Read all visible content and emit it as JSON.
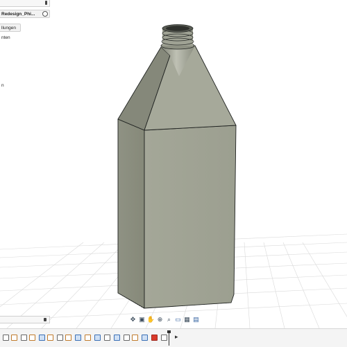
{
  "browser": {
    "component_name": "Redesign_Phi...",
    "settings_label": "llungen",
    "folder_label": "nten",
    "sketch_label": "n"
  },
  "nav_toolbar": {
    "icons": [
      "orbit-icon",
      "look-at-icon",
      "pan-icon",
      "zoom-icon",
      "fit-icon",
      "display-settings-icon",
      "grid-icon",
      "viewports-icon"
    ]
  },
  "timeline": {
    "icon_count": 22,
    "active_index": 19
  },
  "colors": {
    "bottle_fill": "#9b9e8f",
    "bottle_shadow": "#7c7f71",
    "bottle_edge": "#1f2220",
    "grid_line": "#d9d9d9",
    "highlight_red": "#d93a2b",
    "toolbar_blue": "#3a6fb5"
  }
}
